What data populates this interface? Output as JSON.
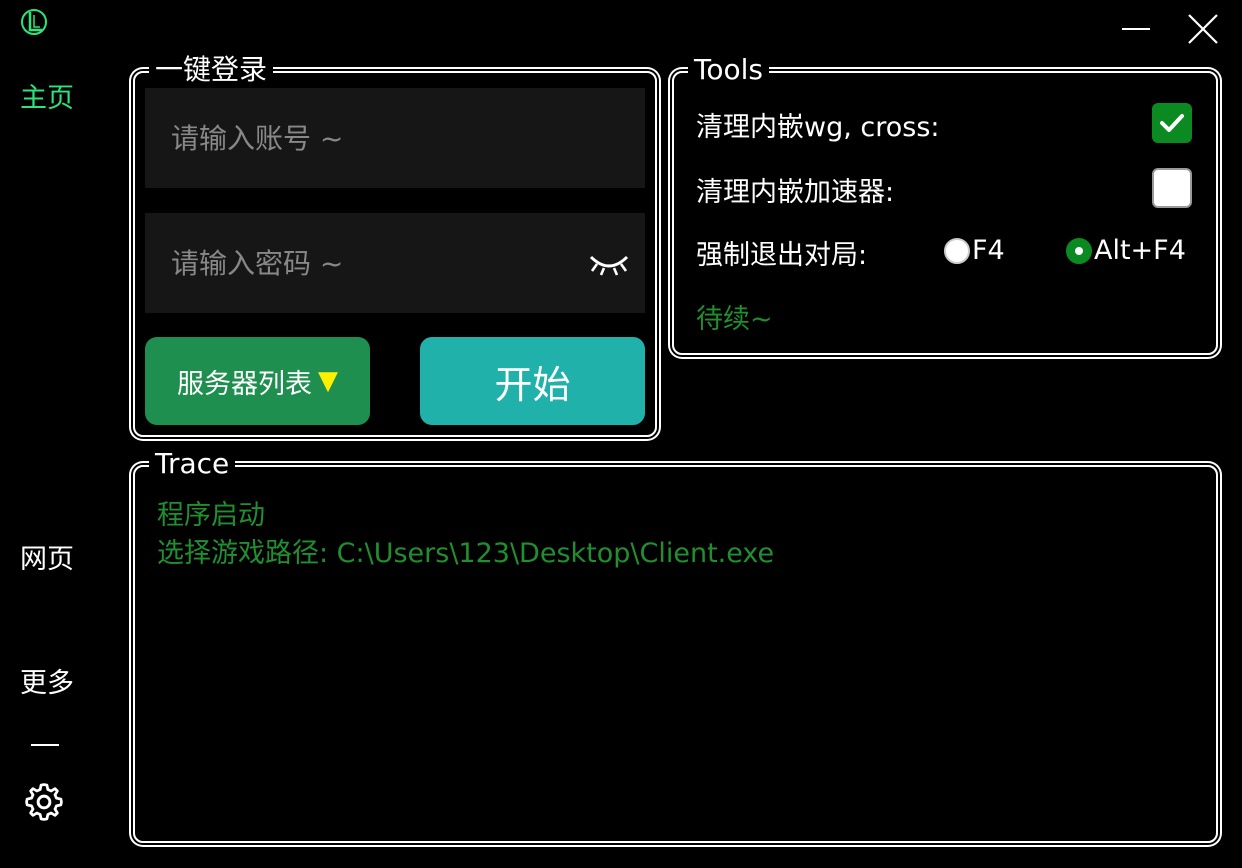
{
  "window": {
    "minimize_icon": "minimize-icon",
    "close_icon": "close-icon"
  },
  "nav": {
    "home": "主页",
    "web": "网页",
    "more": "更多",
    "settings_icon": "gear-icon"
  },
  "login": {
    "title": "一键登录",
    "account_placeholder": "请输入账号 ~",
    "password_placeholder": "请输入密码 ~",
    "server_list_label": "服务器列表",
    "server_list_arrow": "▼",
    "start_label": "开始"
  },
  "tools": {
    "title": "Tools",
    "clean_wg_label": "清理内嵌wg, cross:",
    "clean_wg_checked": true,
    "clean_accel_label": "清理内嵌加速器:",
    "clean_accel_checked": false,
    "force_quit_label": "强制退出对局:",
    "radio_f4_label": "F4",
    "radio_altf4_label": "Alt+F4",
    "selected_radio": "Alt+F4",
    "pending_label": "待续~"
  },
  "trace": {
    "title": "Trace",
    "lines": [
      "程序启动",
      "选择游戏路径: C:\\Users\\123\\Desktop\\Client.exe"
    ]
  },
  "colors": {
    "accent_green": "#2ce57a",
    "log_green": "#1f8f2f",
    "server_button": "#1f8f4f",
    "start_button": "#20b2aa",
    "checkbox_green": "#0a8a20"
  }
}
